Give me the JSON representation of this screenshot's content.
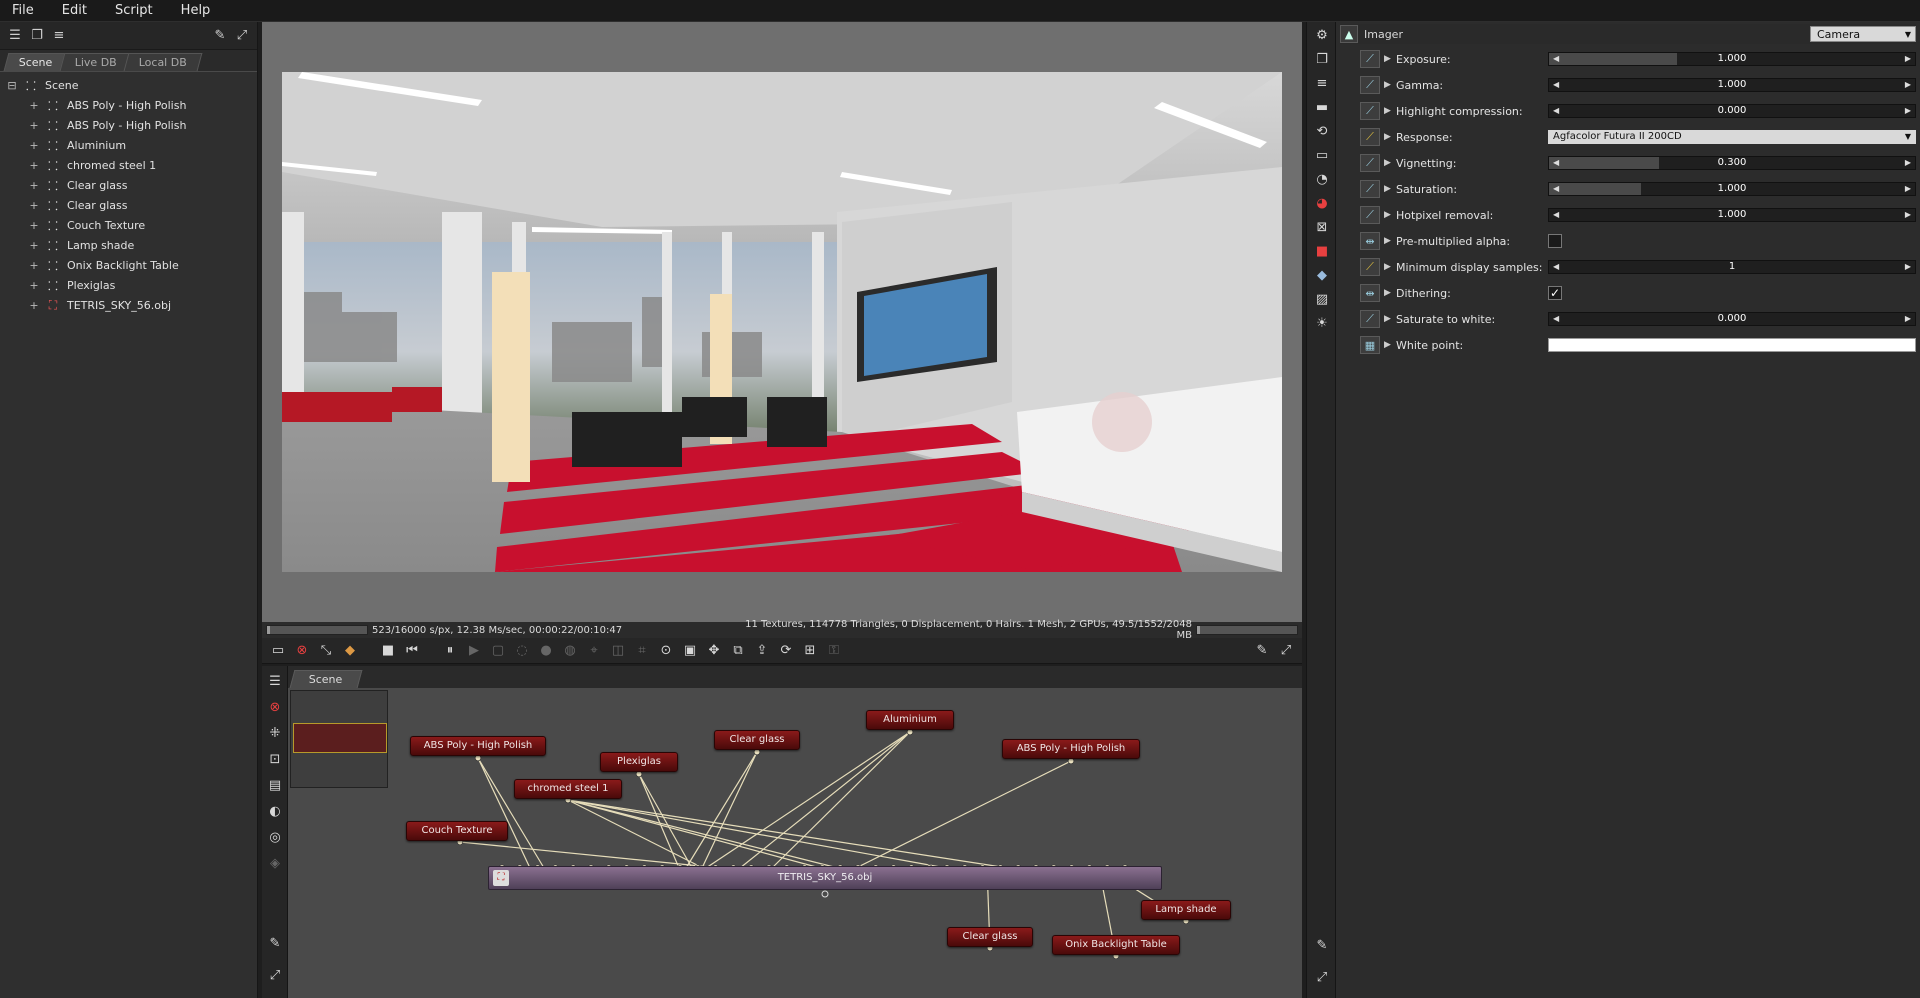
{
  "menu": [
    "File",
    "Edit",
    "Script",
    "Help"
  ],
  "left_tabs": [
    "Scene",
    "Live DB",
    "Local DB"
  ],
  "tree": {
    "root": "Scene",
    "items": [
      "ABS Poly - High  Polish",
      "ABS Poly - High  Polish",
      "Aluminium",
      "chromed steel 1",
      "Clear glass",
      "Clear glass",
      "Couch Texture",
      "Lamp shade",
      "Onix Backlight Table",
      "Plexiglas",
      "TETRIS_SKY_56.obj"
    ]
  },
  "status": {
    "left": "523/16000 s/px, 12.38 Ms/sec, 00:00:22/00:10:47",
    "right": "11 Textures, 114778 Triangles, 0 Displacement, 0 Hairs. 1 Mesh, 2 GPUs, 49.5/1552/2048 MB",
    "progress": 0.033
  },
  "node_graph": {
    "tab": "Scene",
    "mesh": "TETRIS_SKY_56.obj",
    "nodes": {
      "abs1": "ABS Poly - High  Polish",
      "plexi": "Plexiglas",
      "chrome": "chromed steel 1",
      "couch": "Couch Texture",
      "clear1": "Clear glass",
      "alu": "Aluminium",
      "abs2": "ABS Poly - High  Polish",
      "lamp": "Lamp shade",
      "clear2": "Clear glass",
      "onix": "Onix Backlight Table"
    }
  },
  "imager": {
    "title": "Imager",
    "camera": "Camera",
    "params": [
      {
        "label": "Exposure:",
        "kind": "slider",
        "value": "1.000",
        "fill": 0.35
      },
      {
        "label": "Gamma:",
        "kind": "slider",
        "value": "1.000",
        "fill": 0.0
      },
      {
        "label": "Highlight compression:",
        "kind": "slider",
        "value": "0.000",
        "fill": 0.0
      },
      {
        "label": "Response:",
        "kind": "combo",
        "value": "Agfacolor Futura II 200CD"
      },
      {
        "label": "Vignetting:",
        "kind": "slider",
        "value": "0.300",
        "fill": 0.3
      },
      {
        "label": "Saturation:",
        "kind": "slider",
        "value": "1.000",
        "fill": 0.25
      },
      {
        "label": "Hotpixel removal:",
        "kind": "slider",
        "value": "1.000",
        "fill": 0.0
      },
      {
        "label": "Pre-multiplied alpha:",
        "kind": "check",
        "value": ""
      },
      {
        "label": "Minimum display samples:",
        "kind": "slider",
        "value": "1",
        "fill": 0.0
      },
      {
        "label": "Dithering:",
        "kind": "check",
        "value": "✓"
      },
      {
        "label": "Saturate to white:",
        "kind": "slider",
        "value": "0.000",
        "fill": 0.0
      },
      {
        "label": "White point:",
        "kind": "color",
        "value": ""
      }
    ]
  }
}
